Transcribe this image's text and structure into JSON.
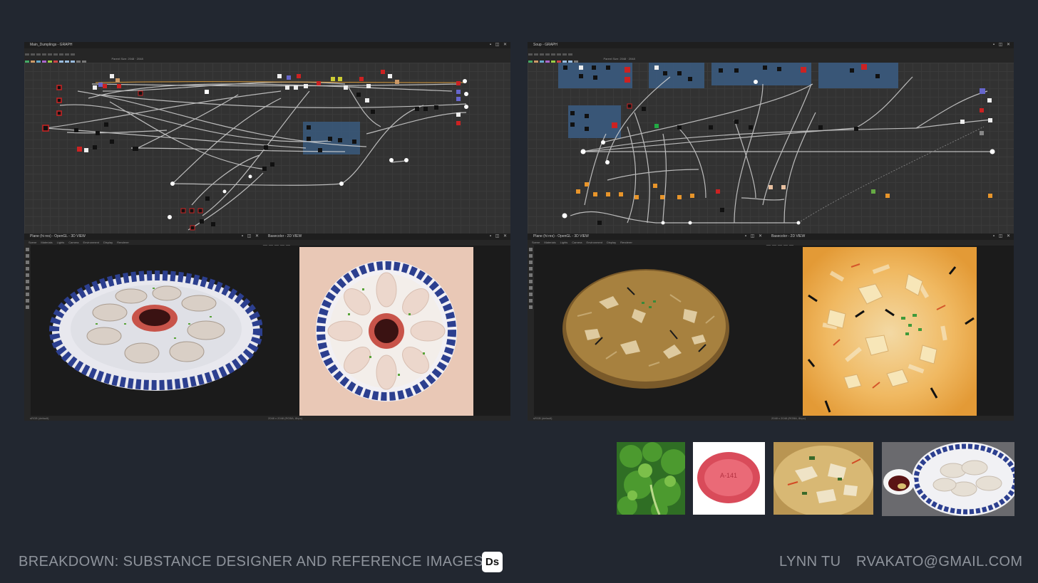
{
  "left_graph": {
    "title": "Main_Dumplings - GRAPH",
    "toolbar_text": "Parent Size: 2048  ·  2048"
  },
  "right_graph": {
    "title": "Soup - GRAPH",
    "toolbar_text": "Parent Size: 2048  ·  2048"
  },
  "view3d_menu": [
    "Scene",
    "Materials",
    "Lights",
    "Camera",
    "Environment",
    "Display",
    "Renderer"
  ],
  "left_3d_view": {
    "title": "Plane (hi res) - OpenGL - 3D VIEW",
    "status": "sRGB (default)"
  },
  "left_2d_view": {
    "title": "Basecolor - 2D VIEW",
    "status": "2048 x 2048 (RGBA, 8bpc)"
  },
  "right_3d_view": {
    "title": "Plane (hi res) - OpenGL - 3D VIEW",
    "status": "sRGB (default)"
  },
  "right_2d_view": {
    "title": "Basecolor - 2D VIEW",
    "status": "2048 x 2048 (RGBA, 8bpc)"
  },
  "reference_images": [
    {
      "name": "cilantro-photo"
    },
    {
      "name": "red-sauce-dish-photo",
      "text": "A-141"
    },
    {
      "name": "hot-sour-soup-photo"
    },
    {
      "name": "dumpling-plate-photo"
    }
  ],
  "footer": {
    "breakdown_text": "BREAKDOWN: SUBSTANCE DESIGNER AND REFERENCE IMAGES",
    "ds_badge": "Ds",
    "author": "LYNN TU",
    "email": "RVAKATO@GMAIL.COM"
  },
  "colors": {
    "background": "#222730",
    "footer_text": "#8f949c",
    "plate_blue": "#2c3f8f",
    "sauce_red": "#c8544a",
    "soup_amber": "#e8a64a",
    "dumpling": "#e6dcd2",
    "frame_bg": "#e9c8b6",
    "frame_soup": "#f4b866"
  },
  "icons": [
    "window-controls-icon",
    "toolbar-tool-icon",
    "viewport-tool-icon"
  ]
}
